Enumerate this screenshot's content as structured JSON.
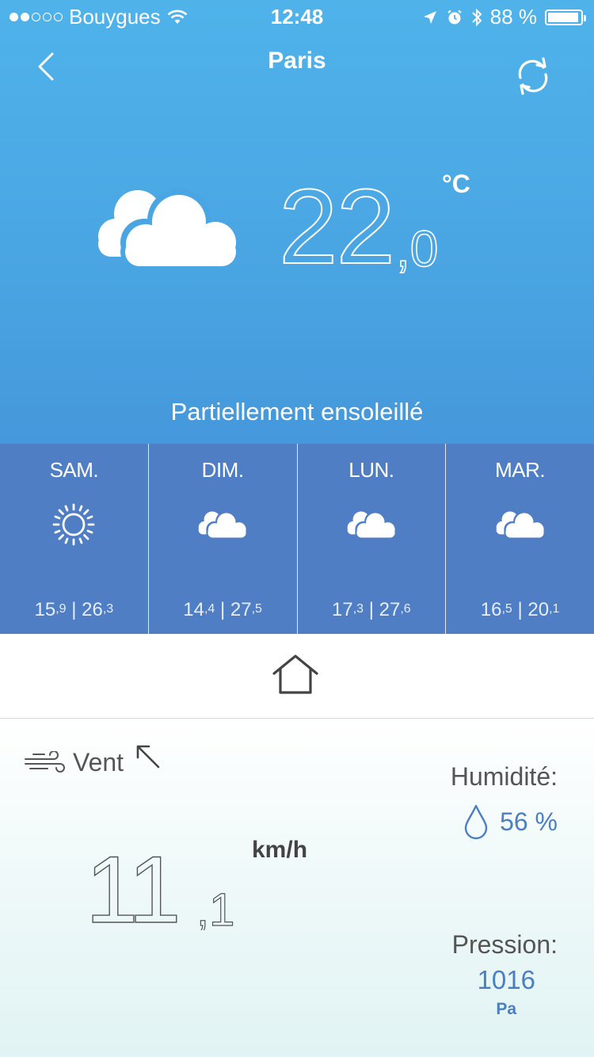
{
  "status_bar": {
    "carrier": "Bouygues",
    "time": "12:48",
    "battery": "88 %",
    "signal_bars_filled": 2,
    "signal_bars_total": 5
  },
  "header": {
    "title": "Paris"
  },
  "current": {
    "temp_int": "22",
    "temp_dec": ",0",
    "unit": "°C",
    "condition": "Partiellement ensoleillé",
    "icon": "cloud-icon"
  },
  "forecast": [
    {
      "day": "SAM.",
      "icon": "sun-icon",
      "min_int": "15",
      "min_dec": ",9",
      "max_int": "26",
      "max_dec": ",3"
    },
    {
      "day": "DIM.",
      "icon": "cloud-icon",
      "min_int": "14",
      "min_dec": ",4",
      "max_int": "27",
      "max_dec": ",5"
    },
    {
      "day": "LUN.",
      "icon": "cloud-icon",
      "min_int": "17",
      "min_dec": ",3",
      "max_int": "27",
      "max_dec": ",6"
    },
    {
      "day": "MAR.",
      "icon": "cloud-icon",
      "min_int": "16",
      "min_dec": ",5",
      "max_int": "20",
      "max_dec": ",1"
    }
  ],
  "details": {
    "wind_label": "Vent",
    "wind_int": "11",
    "wind_dec": ",1",
    "wind_unit": "km/h",
    "humidity_label": "Humidité:",
    "humidity_value": "56 %",
    "pressure_label": "Pression:",
    "pressure_value": "1016",
    "pressure_unit": "Pa"
  },
  "colors": {
    "sky_top": "#4fb3ea",
    "forecast_bg": "#4f7ec5",
    "accent_blue": "#4a7fc2"
  }
}
